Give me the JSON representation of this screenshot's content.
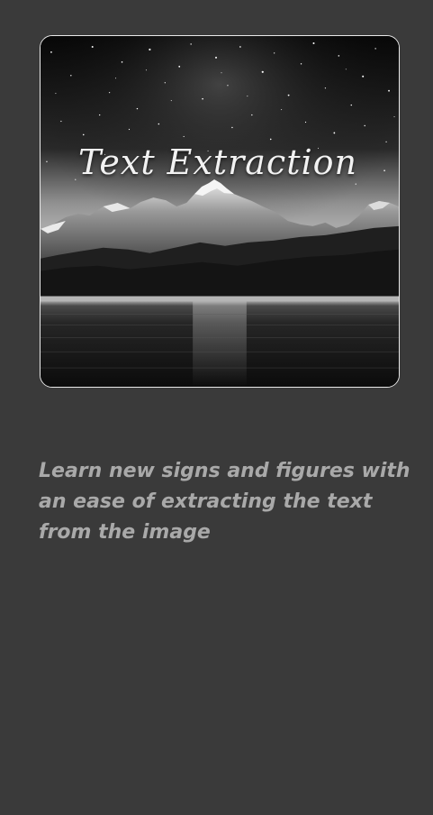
{
  "hero": {
    "image_text": "Text Extraction",
    "image_name": "starry-mountain-lake-image"
  },
  "description": "Learn new signs and figures with an ease of extracting the text from the image",
  "colors": {
    "background": "#3a3a3a",
    "card_border": "#e9e9e9",
    "description_text": "#a9a9a9",
    "title_text": "#f2f2f2"
  }
}
